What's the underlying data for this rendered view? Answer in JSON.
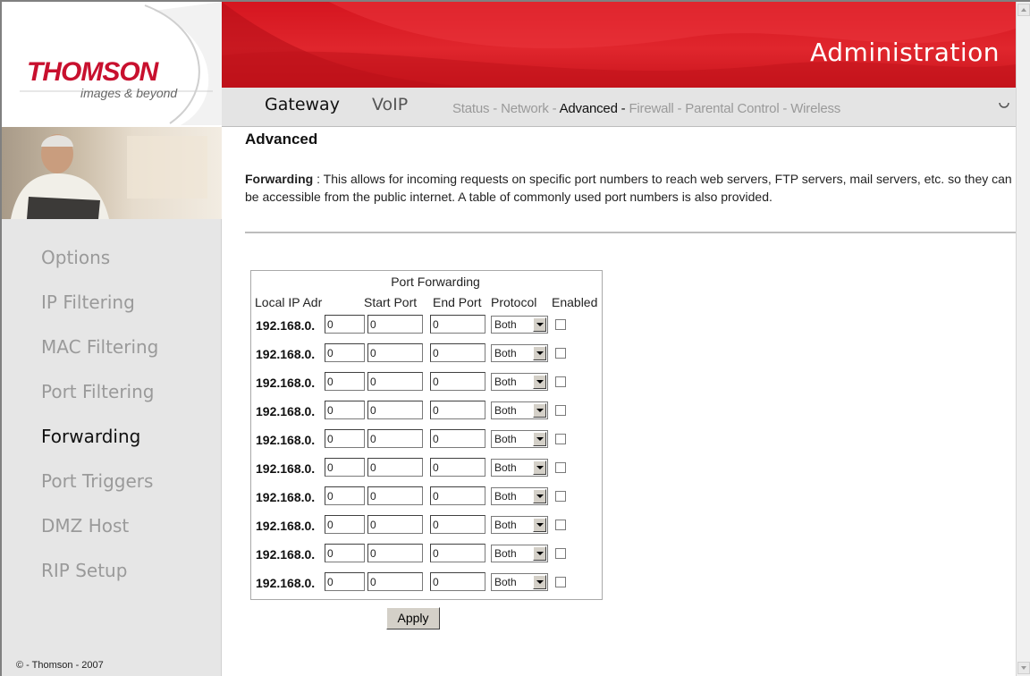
{
  "brand": {
    "logo": "THOMSON",
    "tagline": "images & beyond",
    "banner_title": "Administration",
    "accent_color": "#d5151f"
  },
  "nav": {
    "primary": [
      "Gateway",
      "VoIP"
    ],
    "secondary": [
      "Status",
      "Network",
      "Advanced",
      "Firewall",
      "Parental Control",
      "Wireless"
    ],
    "active_secondary": "Advanced",
    "separator": " - ",
    "spinner_icon": "refresh-icon"
  },
  "sidebar": {
    "items": [
      {
        "label": "Options"
      },
      {
        "label": "IP Filtering"
      },
      {
        "label": "MAC Filtering"
      },
      {
        "label": "Port Filtering"
      },
      {
        "label": "Forwarding"
      },
      {
        "label": "Port Triggers"
      },
      {
        "label": "DMZ Host"
      },
      {
        "label": "RIP Setup"
      }
    ],
    "active": "Forwarding",
    "copyright": "© - Thomson - 2007"
  },
  "page": {
    "heading": "Advanced",
    "desc_term": "Forwarding",
    "desc_sep": " :  ",
    "desc_text": "This allows for incoming requests on specific port numbers to reach web servers, FTP servers, mail servers, etc. so they can be accessible from the public internet. A table of commonly used port numbers is also provided."
  },
  "forwarding_table": {
    "title": "Port Forwarding",
    "headers": {
      "local_ip": "Local IP Adr",
      "start_port": "Start Port",
      "end_port": "End Port",
      "protocol": "Protocol",
      "enabled": "Enabled"
    },
    "rows": [
      {
        "prefix": "192.168.0.",
        "ip": "0",
        "start": "0",
        "end": "0",
        "protocol": "Both",
        "enabled": false
      },
      {
        "prefix": "192.168.0.",
        "ip": "0",
        "start": "0",
        "end": "0",
        "protocol": "Both",
        "enabled": false
      },
      {
        "prefix": "192.168.0.",
        "ip": "0",
        "start": "0",
        "end": "0",
        "protocol": "Both",
        "enabled": false
      },
      {
        "prefix": "192.168.0.",
        "ip": "0",
        "start": "0",
        "end": "0",
        "protocol": "Both",
        "enabled": false
      },
      {
        "prefix": "192.168.0.",
        "ip": "0",
        "start": "0",
        "end": "0",
        "protocol": "Both",
        "enabled": false
      },
      {
        "prefix": "192.168.0.",
        "ip": "0",
        "start": "0",
        "end": "0",
        "protocol": "Both",
        "enabled": false
      },
      {
        "prefix": "192.168.0.",
        "ip": "0",
        "start": "0",
        "end": "0",
        "protocol": "Both",
        "enabled": false
      },
      {
        "prefix": "192.168.0.",
        "ip": "0",
        "start": "0",
        "end": "0",
        "protocol": "Both",
        "enabled": false
      },
      {
        "prefix": "192.168.0.",
        "ip": "0",
        "start": "0",
        "end": "0",
        "protocol": "Both",
        "enabled": false
      },
      {
        "prefix": "192.168.0.",
        "ip": "0",
        "start": "0",
        "end": "0",
        "protocol": "Both",
        "enabled": false
      }
    ],
    "apply_label": "Apply"
  }
}
